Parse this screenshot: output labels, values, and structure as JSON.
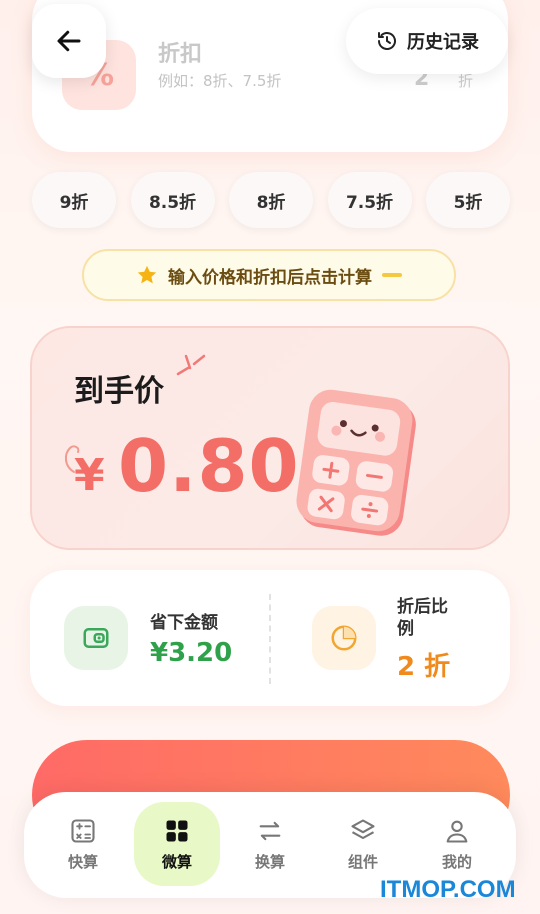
{
  "header": {
    "back_icon": "arrow-left-icon",
    "history_label": "历史记录",
    "history_icon": "history-icon"
  },
  "discount_field": {
    "label": "折扣",
    "placeholder": "例如：8折、7.5折",
    "value": "2",
    "unit": "折",
    "icon": "percent-icon"
  },
  "chips": [
    "9折",
    "8.5折",
    "8折",
    "7.5折",
    "5折"
  ],
  "hint": {
    "text": "输入价格和折扣后点击计算",
    "icon": "star-icon"
  },
  "result": {
    "title": "到手价",
    "currency": "¥",
    "amount": "0.80",
    "illustration": "calculator-illustration"
  },
  "stats": {
    "saved_label": "省下金额",
    "saved_value": "¥3.20",
    "saved_icon": "wallet-icon",
    "ratio_label": "折后比例",
    "ratio_value": "2 折",
    "ratio_icon": "pie-chart-icon"
  },
  "nav": [
    {
      "label": "快算",
      "icon": "calculator-icon"
    },
    {
      "label": "微算",
      "icon": "grid-icon",
      "active": true
    },
    {
      "label": "换算",
      "icon": "swap-icon"
    },
    {
      "label": "组件",
      "icon": "layers-icon"
    },
    {
      "label": "我的",
      "icon": "user-icon"
    }
  ],
  "watermark": "ITMOP.COM",
  "colors": {
    "accent_red": "#f26e66",
    "green": "#2fa14b",
    "orange": "#f08a1c",
    "nav_active_bg": "#e8f8c7"
  }
}
